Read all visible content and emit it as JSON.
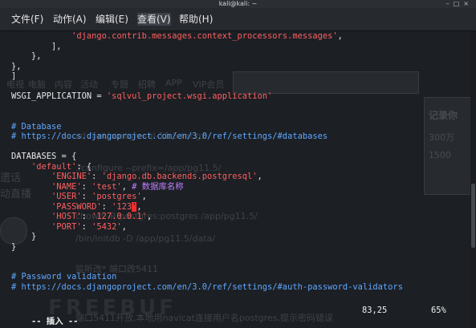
{
  "window": {
    "title": "kali@kali: ~"
  },
  "menubar": {
    "items": [
      {
        "label": "文件(F)"
      },
      {
        "label": "动作(A)"
      },
      {
        "label": "编辑(E)"
      },
      {
        "label": "查看(V)"
      },
      {
        "label": "帮助(H)"
      }
    ]
  },
  "editor": {
    "lines": [
      {
        "segments": [
          {
            "t": "            "
          },
          {
            "t": "'django.contrib.messages.context_processors.messages'",
            "c": "str"
          },
          {
            "t": ","
          }
        ]
      },
      {
        "segments": [
          {
            "t": "        ],"
          }
        ]
      },
      {
        "segments": [
          {
            "t": "    },"
          }
        ]
      },
      {
        "segments": [
          {
            "t": "},"
          }
        ]
      },
      {
        "segments": [
          {
            "t": "]"
          }
        ]
      },
      {
        "segments": [
          {
            "t": ""
          }
        ]
      },
      {
        "segments": [
          {
            "t": "WSGI_APPLICATION = "
          },
          {
            "t": "'sqlvul_project.wsgi.application'",
            "c": "str"
          }
        ]
      },
      {
        "segments": [
          {
            "t": ""
          }
        ]
      },
      {
        "segments": [
          {
            "t": ""
          }
        ]
      },
      {
        "segments": [
          {
            "t": "# Database",
            "c": "cmt"
          }
        ]
      },
      {
        "segments": [
          {
            "t": "# https://docs.djangoproject.com/en/3.0/ref/settings/#databases",
            "c": "cmt"
          }
        ]
      },
      {
        "segments": [
          {
            "t": ""
          }
        ]
      },
      {
        "segments": [
          {
            "t": "DATABASES = {"
          }
        ]
      },
      {
        "segments": [
          {
            "t": "    "
          },
          {
            "t": "'default'",
            "c": "str"
          },
          {
            "t": ": {"
          }
        ]
      },
      {
        "segments": [
          {
            "t": "        "
          },
          {
            "t": "'ENGINE'",
            "c": "str"
          },
          {
            "t": ": "
          },
          {
            "t": "'django.db.backends.postgresql'",
            "c": "str"
          },
          {
            "t": ","
          }
        ]
      },
      {
        "segments": [
          {
            "t": "        "
          },
          {
            "t": "'NAME'",
            "c": "str"
          },
          {
            "t": ": "
          },
          {
            "t": "'test'",
            "c": "str"
          },
          {
            "t": ", "
          },
          {
            "t": "# 数据库名称",
            "c": "zh"
          }
        ]
      },
      {
        "segments": [
          {
            "t": "        "
          },
          {
            "t": "'USER'",
            "c": "str"
          },
          {
            "t": ": "
          },
          {
            "t": "'postgres'",
            "c": "str"
          },
          {
            "t": ","
          }
        ]
      },
      {
        "segments": [
          {
            "t": "        "
          },
          {
            "t": "'PASSWORD'",
            "c": "str"
          },
          {
            "t": ": "
          },
          {
            "t": "'123",
            "c": "str"
          },
          {
            "t": "'",
            "c": "cursor"
          },
          {
            "t": ","
          }
        ]
      },
      {
        "segments": [
          {
            "t": "        "
          },
          {
            "t": "'HOST'",
            "c": "str"
          },
          {
            "t": ": "
          },
          {
            "t": "'127.0.0.1'",
            "c": "str"
          },
          {
            "t": ","
          }
        ]
      },
      {
        "segments": [
          {
            "t": "        "
          },
          {
            "t": "'PORT'",
            "c": "str"
          },
          {
            "t": ": "
          },
          {
            "t": "'5432'",
            "c": "str"
          },
          {
            "t": ","
          }
        ]
      },
      {
        "segments": [
          {
            "t": "    }"
          }
        ]
      },
      {
        "segments": [
          {
            "t": "}"
          }
        ]
      },
      {
        "segments": [
          {
            "t": ""
          }
        ]
      },
      {
        "segments": [
          {
            "t": ""
          }
        ]
      },
      {
        "segments": [
          {
            "t": "# Password validation",
            "c": "cmt"
          }
        ]
      },
      {
        "segments": [
          {
            "t": "# https://docs.djangoproject.com/en/3.0/ref/settings/#auth-password-validators",
            "c": "cmt"
          }
        ]
      }
    ],
    "status": {
      "mode": "-- 插入 --",
      "position": "83,25",
      "percent": "65%"
    }
  },
  "background_page": {
    "texts": [
      {
        "t": "电脑"
      },
      {
        "t": "电视"
      },
      {
        "t": "内容"
      },
      {
        "t": "活动"
      },
      {
        "t": "专题"
      },
      {
        "t": "招聘"
      },
      {
        "t": "APP"
      },
      {
        "t": "VIP会员"
      },
      {
        "t": "记录你"
      },
      {
        "t": "cd /opt/postgresql-11.5.tar.gz"
      },
      {
        "t": "./configure --prefix=/app/pg11.5/"
      },
      {
        "t": "chown -R postgres:postgres /app/pg11.5/"
      },
      {
        "t": "/bin/initdb -D /app/pg11.5/data/"
      },
      {
        "t": "监听改* 端口改5411"
      },
      {
        "t": "端口5411开放,本地用navicat连接用户名postgres,提示密码错误"
      },
      {
        "t": "遗话"
      },
      {
        "t": "动直播"
      },
      {
        "t": "300万"
      },
      {
        "t": "1500"
      }
    ],
    "watermark": "FREEBUF"
  },
  "colors": {
    "background": "#1c1f24",
    "string": "#ff5f5f",
    "comment": "#5fa8ff",
    "chinese_comment": "#c080ff",
    "cursor": "#ff2b2b",
    "text": "#e8e8e8"
  }
}
